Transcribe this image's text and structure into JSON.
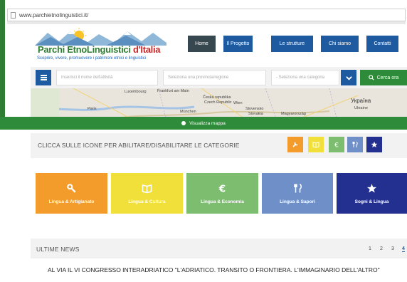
{
  "browser": {
    "url": "www.parchietnolinguistici.it/"
  },
  "logo": {
    "title_part1": "Parchi EtnoLinguistici",
    "title_part2": "d'Italia",
    "tagline": "Scoprire, vivere, promuovere i patrimoni etnici e linguistici"
  },
  "nav": {
    "items": [
      "Home",
      "Il Progetto",
      "Le strutture",
      "Chi siamo",
      "Contatti"
    ],
    "active": "Home"
  },
  "search": {
    "activity_placeholder": "Inserisci il nome dell'attività",
    "province_placeholder": "Seleziona una provincia/regione",
    "category_placeholder": "- Seleziona una categoria",
    "button_label": "Cerca ora"
  },
  "map": {
    "labels": [
      "Luxembourg",
      "Frankfurt am Main",
      "Česká republika",
      "Czech Republic",
      "Slovensko",
      "Slovakia",
      "Magyarország",
      "Україна",
      "Ukraine",
      "Paris",
      "München",
      "Wien"
    ],
    "toggle_label": "Visualizza mappa"
  },
  "categories": {
    "instruction": "CLICCA SULLE ICONE PER ABILITARE/DISABILITARE LE CATEGORIE",
    "toggles": [
      {
        "icon": "tools-icon",
        "color": "#f39c2b"
      },
      {
        "icon": "book-icon",
        "color": "#f1e03a"
      },
      {
        "icon": "euro-icon",
        "color": "#7cbd6f"
      },
      {
        "icon": "cutlery-icon",
        "color": "#6f8fc9"
      },
      {
        "icon": "star-icon",
        "color": "#24308f"
      }
    ],
    "tiles": [
      {
        "label": "Lingua & Artigianato",
        "color": "#f39c2b",
        "icon": "tools-icon"
      },
      {
        "label": "Lingua & Cultura",
        "color": "#f1e03a",
        "icon": "book-icon"
      },
      {
        "label": "Lingua & Economia",
        "color": "#7cbd6f",
        "icon": "euro-icon"
      },
      {
        "label": "Lingua & Sapori",
        "color": "#6f8fc9",
        "icon": "cutlery-icon"
      },
      {
        "label": "Sogni & Lingua",
        "color": "#24308f",
        "icon": "star-icon"
      }
    ]
  },
  "news": {
    "heading": "ULTIME NEWS",
    "pages": [
      "1",
      "2",
      "3",
      "4"
    ],
    "current_page": "4",
    "headline": "AL VIA IL VI CONGRESSO INTERADRIATICO \"L'ADRIATICO. TRANSITO O FRONTIERA. L'IMMAGINARIO DELL'ALTRO\""
  }
}
